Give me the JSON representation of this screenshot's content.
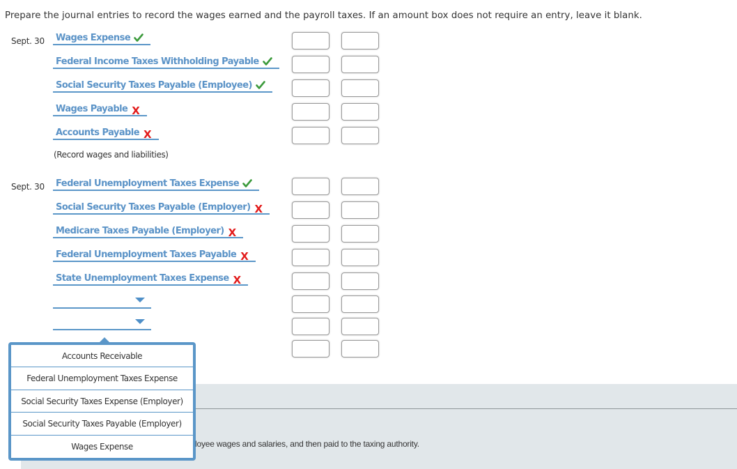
{
  "instructions": "Prepare the journal entries to record the wages earned and the payroll taxes. If an amount box does not require an entry, leave it blank.",
  "entries": [
    {
      "date": "Sept. 30",
      "lines": [
        {
          "account": "Wages Expense",
          "status": "correct"
        },
        {
          "account": "Federal Income Taxes Withholding Payable",
          "status": "correct"
        },
        {
          "account": "Social Security Taxes Payable (Employee)",
          "status": "correct"
        },
        {
          "account": "Wages Payable",
          "status": "incorrect"
        },
        {
          "account": "Accounts Payable",
          "status": "incorrect"
        }
      ],
      "note": "(Record wages and liabilities)"
    },
    {
      "date": "Sept. 30",
      "lines": [
        {
          "account": "Federal Unemployment Taxes Expense",
          "status": "correct"
        },
        {
          "account": "Social Security Taxes Payable (Employer)",
          "status": "incorrect"
        },
        {
          "account": "Medicare Taxes Payable (Employer)",
          "status": "incorrect"
        },
        {
          "account": "Federal Unemployment Taxes Payable",
          "status": "incorrect"
        },
        {
          "account": "State Unemployment Taxes Expense",
          "status": "incorrect"
        },
        {
          "account": "",
          "status": "empty"
        },
        {
          "account": "",
          "status": "empty"
        }
      ]
    }
  ],
  "marks": {
    "correct": "✓",
    "incorrect": "X"
  },
  "amounts": {
    "debit": "",
    "credit": ""
  },
  "dropdown": {
    "options": [
      "Accounts Receivable",
      "Federal Unemployment Taxes Expense",
      "Social Security Taxes Expense (Employer)",
      "Social Security Taxes Payable (Employer)",
      "Wages Expense"
    ]
  },
  "explanation_fragment": "loyee wages and salaries, and then paid to the taxing authority.",
  "colors": {
    "account_text": "#5b93c7",
    "underline": "#5a96c8",
    "correct": "#3b9a3b",
    "incorrect": "#e21b1b",
    "panel": "#e1e7ea"
  }
}
